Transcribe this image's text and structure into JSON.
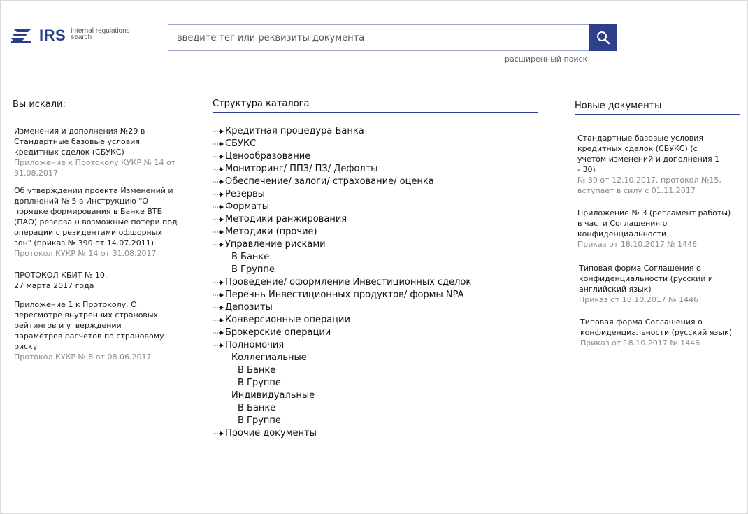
{
  "header": {
    "logo_text": "IRS",
    "logo_sub_line1": "internal regulations",
    "logo_sub_line2": "search",
    "search_placeholder": "введите тег или реквизиты документа",
    "advanced_search": "расширенный поиск"
  },
  "searched": {
    "title": "Вы искали:",
    "items": [
      {
        "text": "Изменения и дополнения №29 в Стандартные базовые условия кредитных сделок (СБУКС)",
        "meta": "Приложение к Протоколу КУКР № 14 от 31.08.2017"
      },
      {
        "text": "Об утверждении проекта Изменений и доплнений № 5 в Инструкцию \"О порядке формирования в Банке ВТБ (ПАО) резерва н возможные потери под операции с резидентами офшорных зон\" (приказ № 390 от 14.07.2011)",
        "meta": "Протокол КУКР № 14 от 31.08.2017"
      },
      {
        "text": "ПРОТОКОЛ КБИТ № 10. 27 марта 2017 года",
        "meta": ""
      },
      {
        "text": "Приложение 1 к Протоколу. О пересмотре внутренних страновых рейтингов и утверждении параметров расчетов по страновому риску",
        "meta": "Протокол КУКР № 8 от 08.06.2017"
      }
    ]
  },
  "catalog": {
    "title": "Структура каталога",
    "rows": [
      {
        "label": "Кредитная процедура Банка",
        "level": 0
      },
      {
        "label": "СБУКС",
        "level": 0
      },
      {
        "label": "Ценообразование",
        "level": 0
      },
      {
        "label": "Мониторинг/ ППЗ/ ПЗ/ Дефолты",
        "level": 0
      },
      {
        "label": "Обеспечение/ залоги/ страхование/ оценка",
        "level": 0
      },
      {
        "label": "Резервы",
        "level": 0
      },
      {
        "label": "Форматы",
        "level": 0
      },
      {
        "label": "Методики ранжирования",
        "level": 0
      },
      {
        "label": "Методики (прочие)",
        "level": 0
      },
      {
        "label": "Управление рисками",
        "level": 0
      },
      {
        "label": "В Банке",
        "level": 1
      },
      {
        "label": "В Группе",
        "level": 1
      },
      {
        "label": "Проведение/ оформление Инвестиционных сделок",
        "level": 0
      },
      {
        "label": "Перечнь Инвестиционных продуктов/ формы NPA",
        "level": 0
      },
      {
        "label": "Депозиты",
        "level": 0
      },
      {
        "label": "Конверсионные операции",
        "level": 0
      },
      {
        "label": "Брокерские операции",
        "level": 0
      },
      {
        "label": "Полномочия",
        "level": 0
      },
      {
        "label": "Коллегиальные",
        "level": 1
      },
      {
        "label": "В Банке",
        "level": 2
      },
      {
        "label": "В Группе",
        "level": 2
      },
      {
        "label": "Индивидуальные",
        "level": 1
      },
      {
        "label": "В Банке",
        "level": 2
      },
      {
        "label": "В Группе",
        "level": 2
      },
      {
        "label": "Прочие документы",
        "level": 0
      }
    ]
  },
  "new_docs": {
    "title": "Новые документы",
    "items": [
      {
        "text": "Стандартные базовые условия кредитных сделок (СБУКС) (с учетом изменений и дополнения 1 - 30)",
        "meta": "№ 30 от 12.10.2017, протокол №15, вступает в силу с 01.11.2017"
      },
      {
        "text": "Приложение № 3 (регламент работы) в части Соглашения о конфиденциальности",
        "meta": "Приказ от 18.10.2017 № 1446"
      },
      {
        "text": "Типовая форма Соглашения о конфиденциальности (русский и английский язык)",
        "meta": "Приказ от 18.10.2017 № 1446"
      },
      {
        "text": "Типовая форма Соглашения о конфиденциальности (русский язык)",
        "meta": "Приказ от 18.10.2017 № 1446"
      }
    ]
  },
  "colors": {
    "accent": "#2f3f8c",
    "meta": "#8a8a8a"
  },
  "icons": {
    "search": "magnifier-icon",
    "arrow": "dashed-arrow-icon",
    "logo": "irs-logo-icon"
  }
}
